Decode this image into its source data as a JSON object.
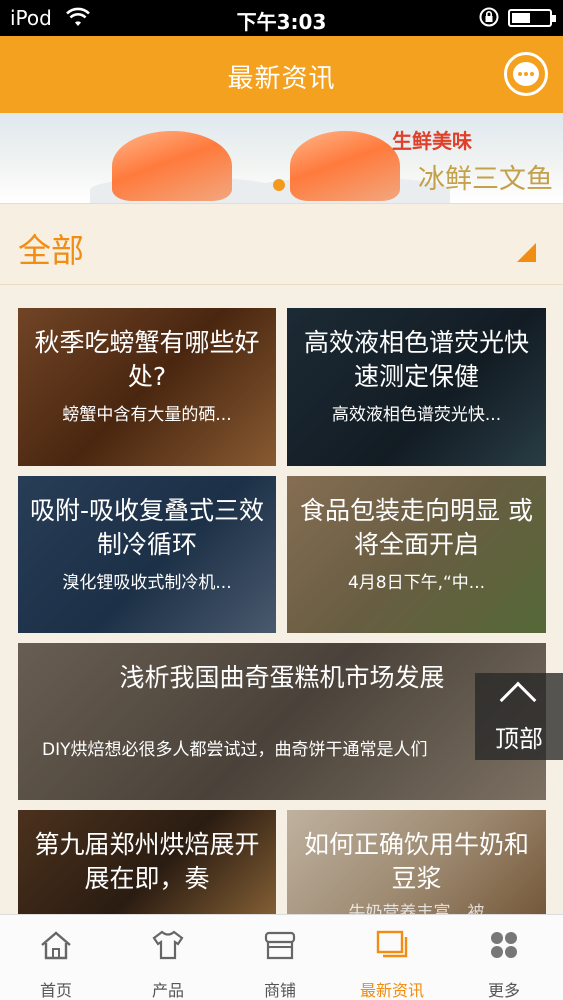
{
  "status_bar": {
    "carrier": "iPod",
    "time": "下午3:03"
  },
  "header": {
    "title": "最新资讯",
    "chat_icon": "chat-bubble-icon"
  },
  "banner": {
    "tagline": "生鲜美味",
    "subtitle": "冰鲜三文鱼"
  },
  "category": {
    "label": "全部"
  },
  "news": [
    {
      "title": "秋季吃螃蟹有哪些好处?",
      "desc": "螃蟹中含有大量的硒..."
    },
    {
      "title": "高效液相色谱荧光快速测定保健",
      "desc": "高效液相色谱荧光快..."
    },
    {
      "title": "吸附-吸收复叠式三效制冷循环",
      "desc": "溴化锂吸收式制冷机..."
    },
    {
      "title": "食品包装走向明显 或将全面开启",
      "desc": "4月8日下午,“中..."
    },
    {
      "title": "浅析我国曲奇蛋糕机市场发展",
      "desc": "DIY烘焙想必很多人都尝试过，曲奇饼干通常是人们"
    },
    {
      "title": "第九届郑州烘焙展开展在即，奏",
      "desc": ""
    },
    {
      "title": "如何正确饮用牛奶和豆浆",
      "desc": "牛奶营养丰富，被"
    }
  ],
  "back_to_top": {
    "label": "顶部"
  },
  "tabbar": {
    "items": [
      {
        "label": "首页",
        "icon": "home-icon"
      },
      {
        "label": "产品",
        "icon": "shirt-icon"
      },
      {
        "label": "商铺",
        "icon": "shop-icon"
      },
      {
        "label": "最新资讯",
        "icon": "news-icon"
      },
      {
        "label": "更多",
        "icon": "grid-icon"
      }
    ],
    "active_index": 3
  },
  "colors": {
    "accent": "#f4a120",
    "accent_text": "#f08d12"
  }
}
